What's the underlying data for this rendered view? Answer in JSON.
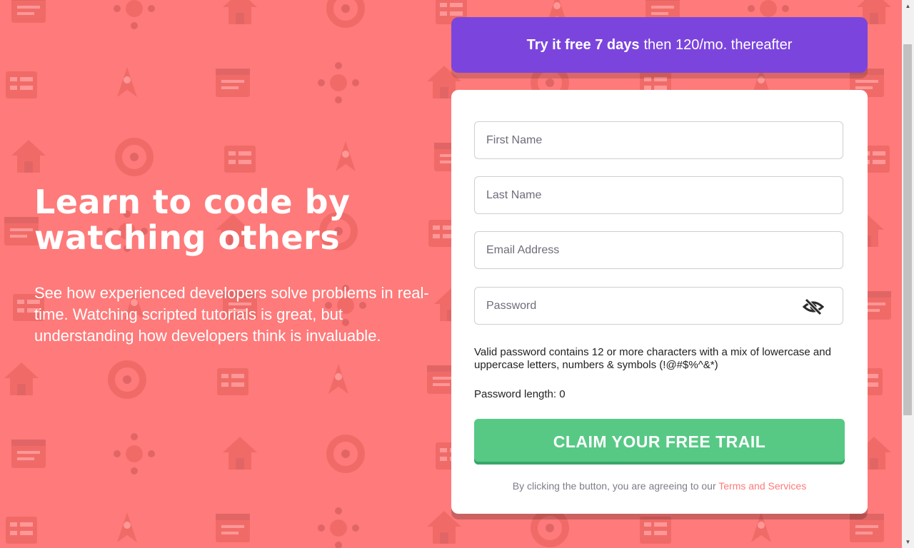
{
  "hero": {
    "headline_line1": "Learn to code by",
    "headline_line2": "watching others",
    "description": "See how experienced developers solve problems in real-time. Watching scripted tutorials is great, but understanding how developers think is invaluable."
  },
  "promo": {
    "bold": "Try it free 7 days",
    "rest": "then 120/mo. thereafter",
    "background_color": "#7b45dd"
  },
  "form": {
    "first_name_placeholder": "First Name",
    "last_name_placeholder": "Last Name",
    "email_placeholder": "Email Address",
    "password_placeholder": "Password",
    "password_toggle_icon": "eye-slash-icon",
    "password_hint": "Valid password contains 12 or more characters with a mix of lowercase and uppercase letters, numbers & symbols (!@#$%^&*)",
    "password_length_label": "Password length: 0",
    "submit_label": "CLAIM YOUR FREE TRAIL",
    "submit_color": "#57c985",
    "terms_prefix": "By clicking the button, you are agreeing to our",
    "terms_link": "Terms and Services"
  },
  "theme": {
    "background_color": "#ff7a7a",
    "accent_link_color": "#ff7a7a"
  }
}
